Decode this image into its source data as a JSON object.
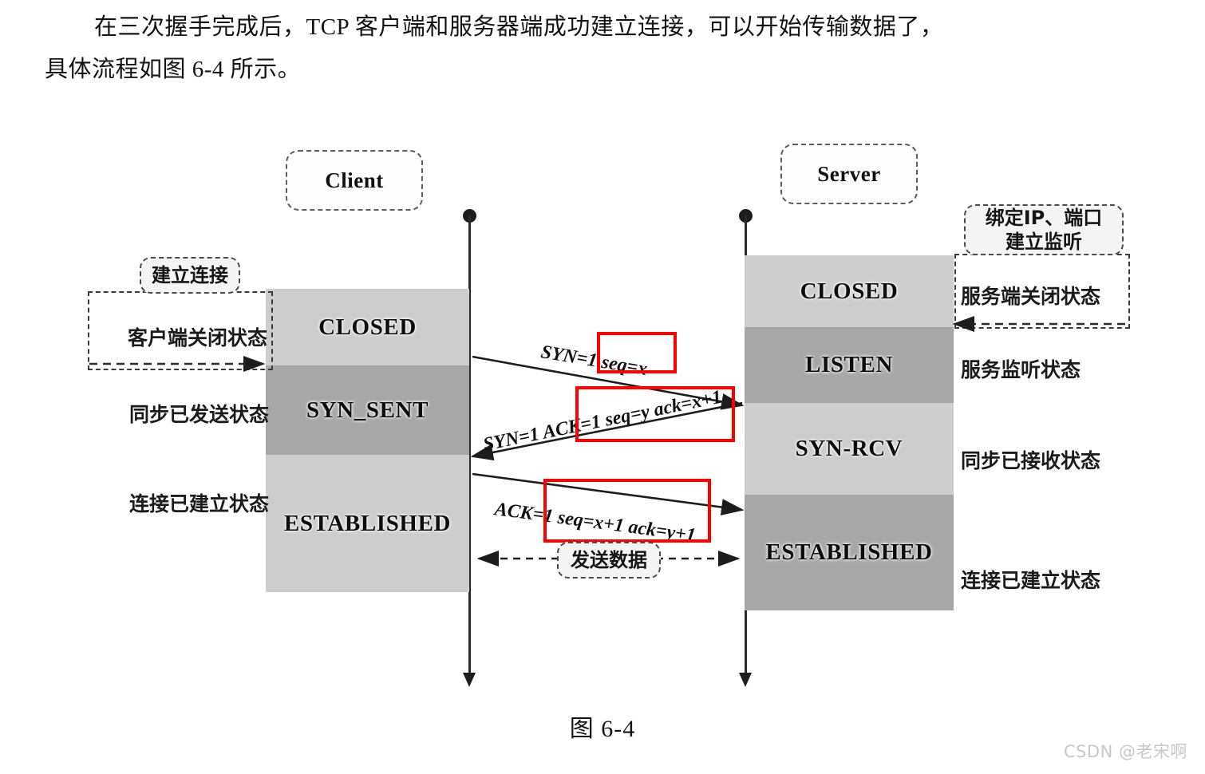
{
  "paragraph": {
    "line1": "在三次握手完成后，TCP 客户端和服务器端成功建立连接，可以开始传输数据了，",
    "line2": "具体流程如图 6-4 所示。"
  },
  "figure": {
    "caption": "图 6-4",
    "client": {
      "title": "Client",
      "states": [
        {
          "label": "CLOSED",
          "shade": "light"
        },
        {
          "label": "SYN_SENT",
          "shade": "dark"
        },
        {
          "label": "ESTABLISHED",
          "shade": "light"
        }
      ],
      "annotations": [
        "客户端关闭状态",
        "同步已发送状态",
        "连接已建立状态"
      ],
      "note": "建立连接"
    },
    "server": {
      "title": "Server",
      "states": [
        {
          "label": "CLOSED",
          "shade": "light"
        },
        {
          "label": "LISTEN",
          "shade": "dark"
        },
        {
          "label": "SYN-RCV",
          "shade": "light"
        },
        {
          "label": "ESTABLISHED",
          "shade": "dark"
        }
      ],
      "annotations": [
        "服务端关闭状态",
        "服务监听状态",
        "同步已接收状态",
        "连接已建立状态"
      ],
      "note_line1": "绑定IP、端口",
      "note_line2": "建立监听"
    },
    "messages": [
      {
        "id": "syn",
        "text": "SYN=1 seq=x",
        "direction": "client-to-server"
      },
      {
        "id": "synack",
        "text": "SYN=1 ACK=1 seq=y ack=x+1",
        "direction": "server-to-client"
      },
      {
        "id": "ack",
        "text": "ACK=1 seq=x+1  ack=y+1",
        "direction": "client-to-server"
      }
    ],
    "data_note": "发送数据",
    "highlight_color": "#ff0000"
  },
  "watermark": "CSDN @老宋啊"
}
